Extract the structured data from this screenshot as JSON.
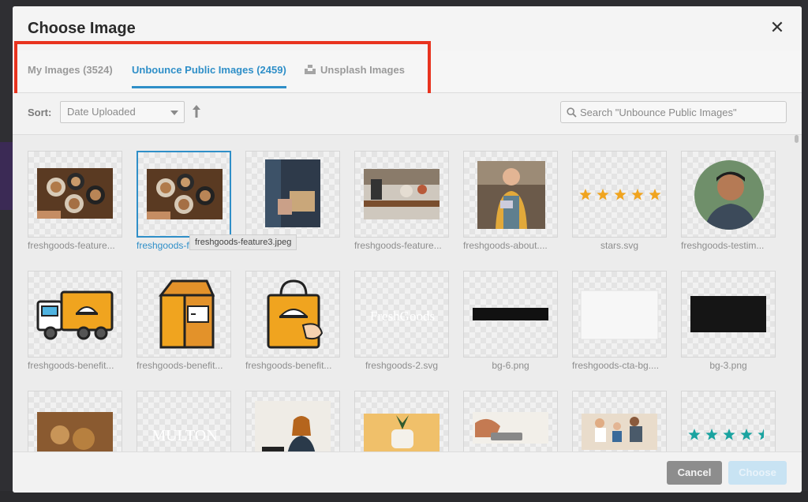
{
  "modal": {
    "title": "Choose Image",
    "close_symbol": "✕"
  },
  "tabs": [
    {
      "label": "My Images (3524)",
      "active": false
    },
    {
      "label": "Unbounce Public Images (2459)",
      "active": true
    },
    {
      "label": "Unsplash Images",
      "active": false,
      "icon": "unsplash-icon"
    }
  ],
  "toolbar": {
    "sort_label": "Sort:",
    "sort_value": "Date Uploaded",
    "sort_direction_icon": "arrow-up-icon",
    "search_placeholder": "Search \"Unbounce Public Images\""
  },
  "images": [
    {
      "name": "freshgoods-feature...",
      "kind": "coffee-photo"
    },
    {
      "name": "freshgoods-fea",
      "kind": "coffee-photo",
      "selected": true
    },
    {
      "name": "eature...",
      "kind": "delivery-photo"
    },
    {
      "name": "freshgoods-feature...",
      "kind": "kitchen-photo"
    },
    {
      "name": "freshgoods-about....",
      "kind": "barista-photo"
    },
    {
      "name": "stars.svg",
      "kind": "stars-orange"
    },
    {
      "name": "freshgoods-testim...",
      "kind": "portrait-photo"
    },
    {
      "name": "freshgoods-benefit...",
      "kind": "truck-illustration"
    },
    {
      "name": "freshgoods-benefit...",
      "kind": "bag-illustration"
    },
    {
      "name": "freshgoods-benefit...",
      "kind": "handbag-illustration"
    },
    {
      "name": "freshgoods-2.svg",
      "kind": "logo-white",
      "text": "FreshGoods"
    },
    {
      "name": "bg-6.png",
      "kind": "black-bar"
    },
    {
      "name": "freshgoods-cta-bg....",
      "kind": "white-paper"
    },
    {
      "name": "bg-3.png",
      "kind": "black-block"
    },
    {
      "name": "",
      "kind": "bakery-photo"
    },
    {
      "name": "",
      "kind": "logo-white-2",
      "text": "MULTON"
    },
    {
      "name": "",
      "kind": "woman-laptop-photo"
    },
    {
      "name": "",
      "kind": "plant-photo"
    },
    {
      "name": "",
      "kind": "tablet-photo"
    },
    {
      "name": "",
      "kind": "team-photo"
    },
    {
      "name": "",
      "kind": "stars-teal"
    }
  ],
  "tooltip": "freshgoods-feature3.jpeg",
  "footer": {
    "cancel_label": "Cancel",
    "choose_label": "Choose"
  }
}
